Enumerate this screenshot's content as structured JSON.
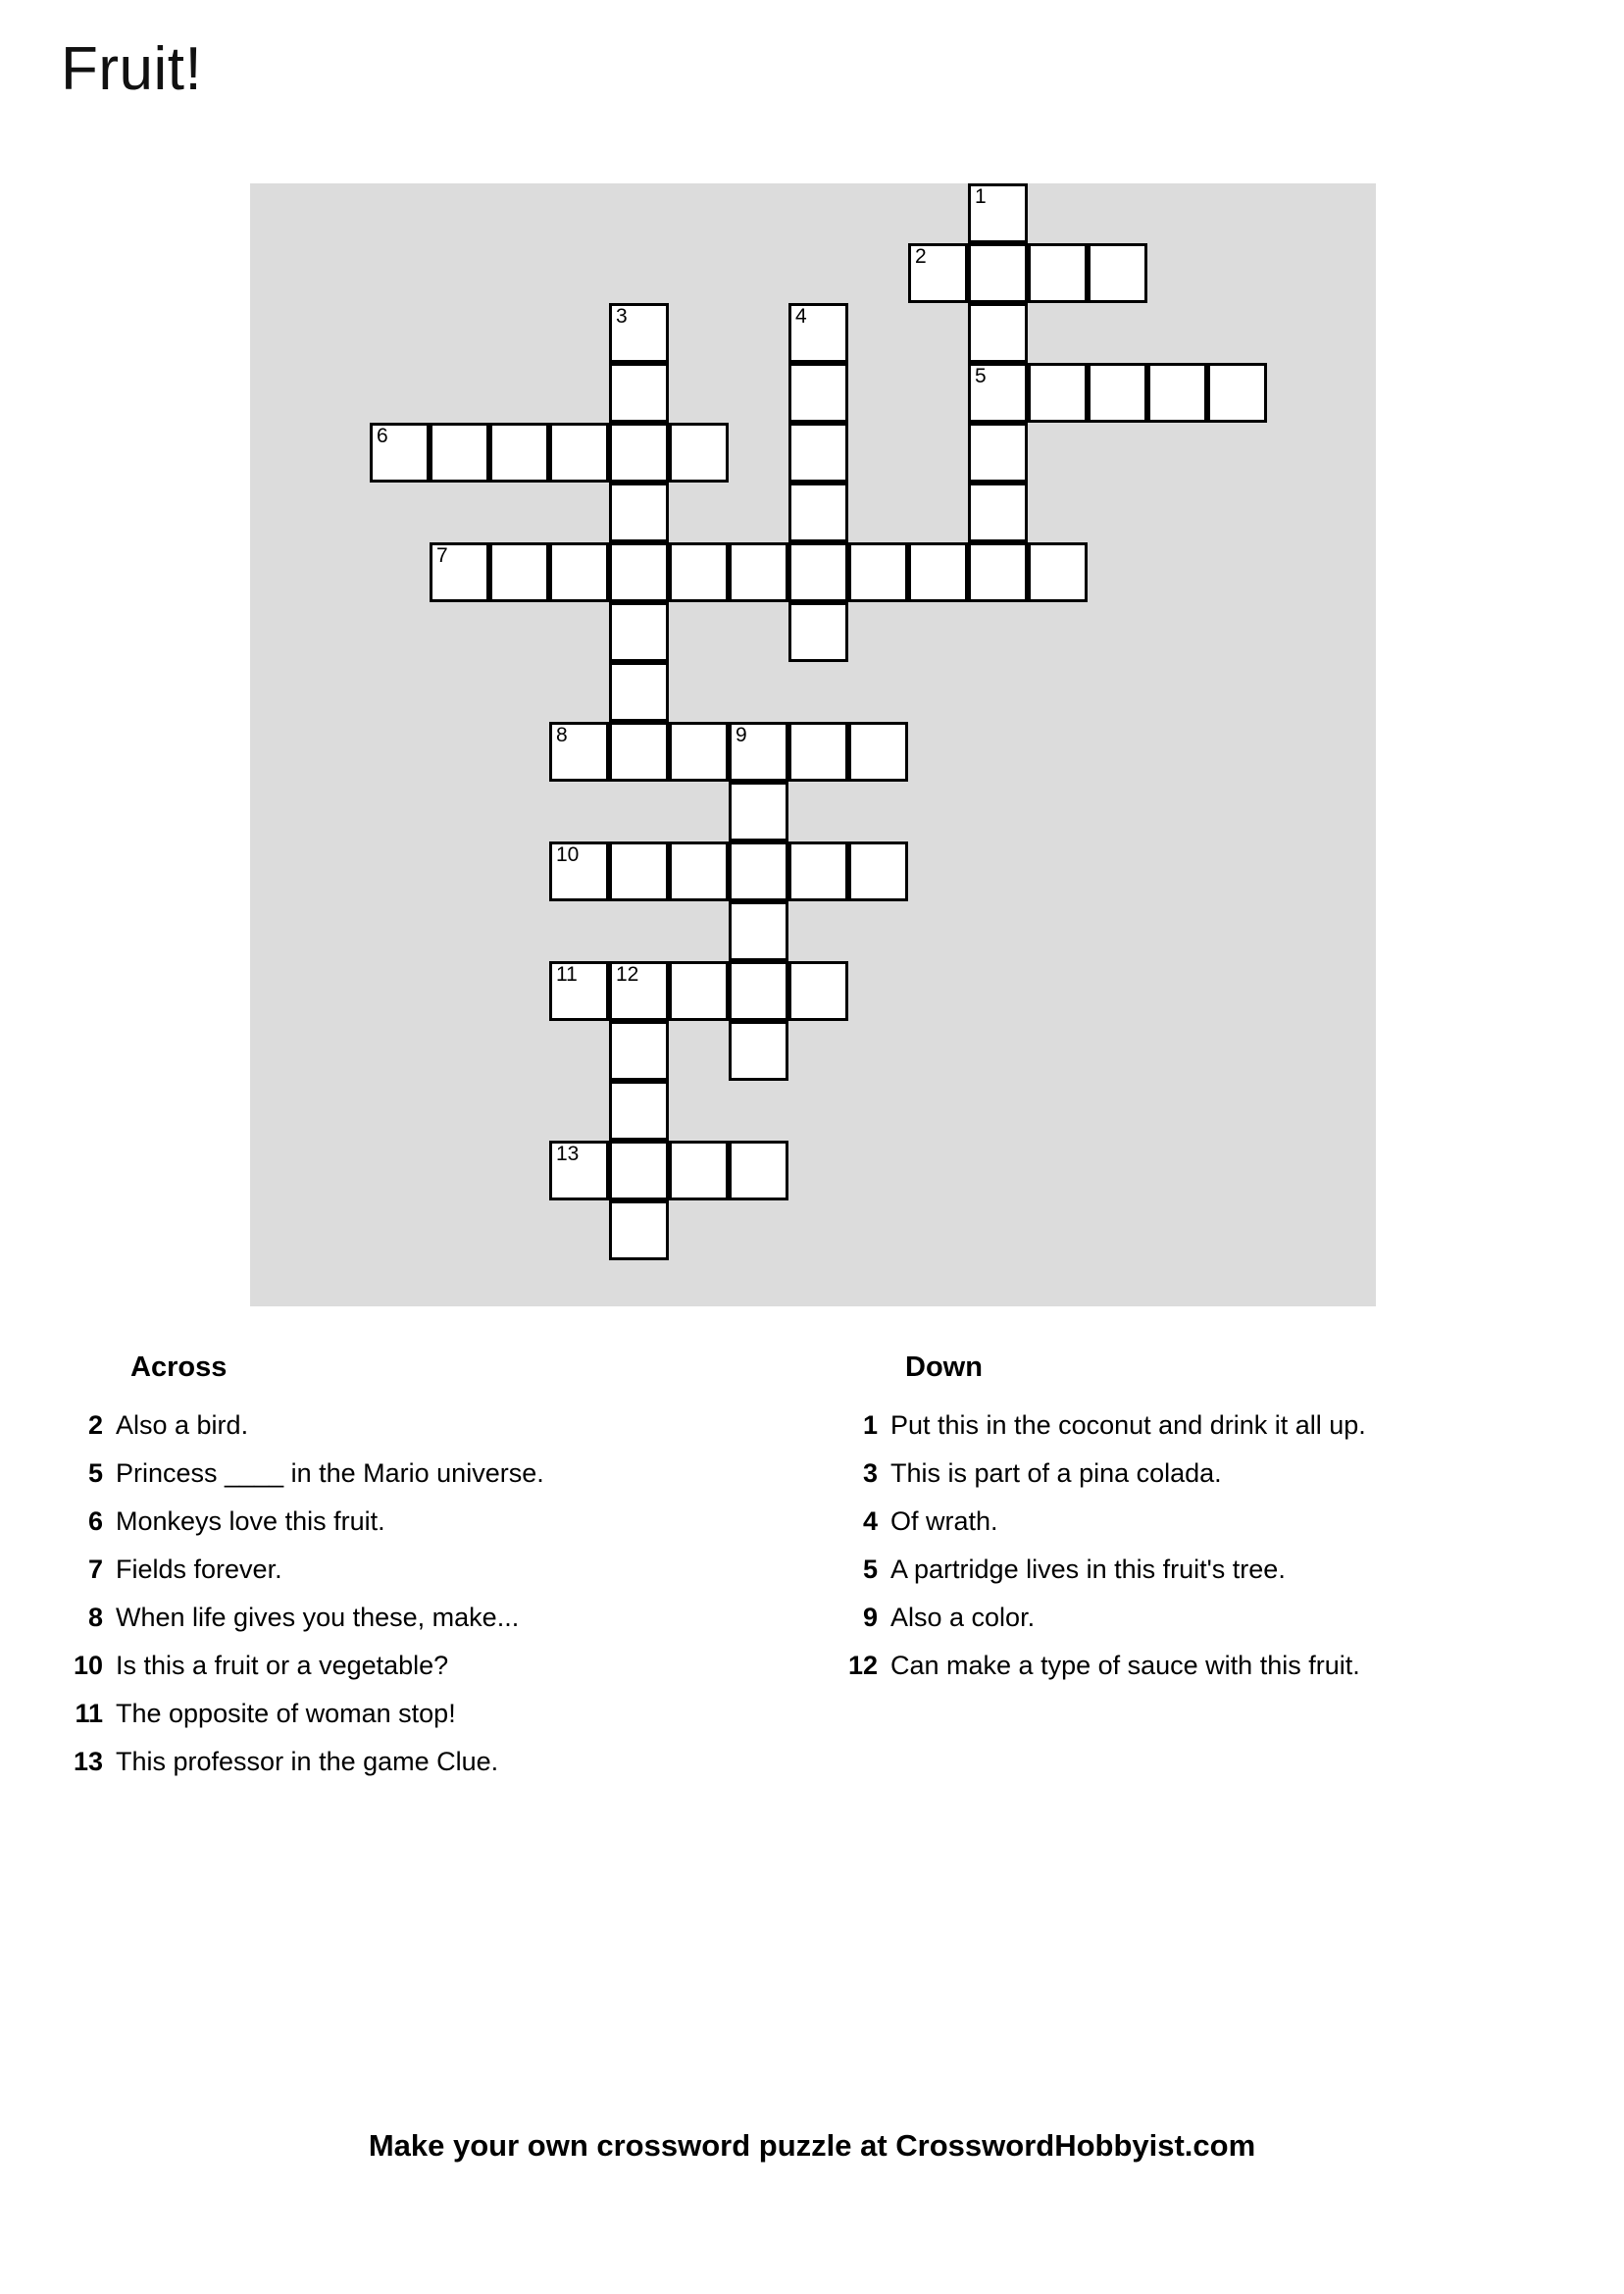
{
  "page": {
    "title": "Fruit!",
    "footer": "Make your own crossword puzzle at CrosswordHobbyist.com",
    "grid_background_color": "#dcdcdc",
    "cell_fill_color": "#ffffff",
    "cell_border_color": "#000000"
  },
  "grid": {
    "cell_size": 61,
    "columns": 19,
    "rows": 19,
    "cells": [
      {
        "row": 0,
        "col": 12,
        "num": "1"
      },
      {
        "row": 1,
        "col": 11,
        "num": "2"
      },
      {
        "row": 1,
        "col": 12,
        "num": ""
      },
      {
        "row": 1,
        "col": 13,
        "num": ""
      },
      {
        "row": 1,
        "col": 14,
        "num": ""
      },
      {
        "row": 2,
        "col": 6,
        "num": "3"
      },
      {
        "row": 2,
        "col": 9,
        "num": "4"
      },
      {
        "row": 2,
        "col": 12,
        "num": ""
      },
      {
        "row": 3,
        "col": 6,
        "num": ""
      },
      {
        "row": 3,
        "col": 9,
        "num": ""
      },
      {
        "row": 3,
        "col": 12,
        "num": "5"
      },
      {
        "row": 3,
        "col": 13,
        "num": ""
      },
      {
        "row": 3,
        "col": 14,
        "num": ""
      },
      {
        "row": 3,
        "col": 15,
        "num": ""
      },
      {
        "row": 3,
        "col": 16,
        "num": ""
      },
      {
        "row": 4,
        "col": 2,
        "num": "6"
      },
      {
        "row": 4,
        "col": 3,
        "num": ""
      },
      {
        "row": 4,
        "col": 4,
        "num": ""
      },
      {
        "row": 4,
        "col": 5,
        "num": ""
      },
      {
        "row": 4,
        "col": 6,
        "num": ""
      },
      {
        "row": 4,
        "col": 7,
        "num": ""
      },
      {
        "row": 4,
        "col": 9,
        "num": ""
      },
      {
        "row": 4,
        "col": 12,
        "num": ""
      },
      {
        "row": 5,
        "col": 6,
        "num": ""
      },
      {
        "row": 5,
        "col": 9,
        "num": ""
      },
      {
        "row": 5,
        "col": 12,
        "num": ""
      },
      {
        "row": 6,
        "col": 3,
        "num": "7"
      },
      {
        "row": 6,
        "col": 4,
        "num": ""
      },
      {
        "row": 6,
        "col": 5,
        "num": ""
      },
      {
        "row": 6,
        "col": 6,
        "num": ""
      },
      {
        "row": 6,
        "col": 7,
        "num": ""
      },
      {
        "row": 6,
        "col": 8,
        "num": ""
      },
      {
        "row": 6,
        "col": 9,
        "num": ""
      },
      {
        "row": 6,
        "col": 10,
        "num": ""
      },
      {
        "row": 6,
        "col": 11,
        "num": ""
      },
      {
        "row": 6,
        "col": 12,
        "num": ""
      },
      {
        "row": 6,
        "col": 13,
        "num": ""
      },
      {
        "row": 7,
        "col": 6,
        "num": ""
      },
      {
        "row": 7,
        "col": 9,
        "num": ""
      },
      {
        "row": 8,
        "col": 6,
        "num": ""
      },
      {
        "row": 9,
        "col": 5,
        "num": "8"
      },
      {
        "row": 9,
        "col": 6,
        "num": ""
      },
      {
        "row": 9,
        "col": 7,
        "num": ""
      },
      {
        "row": 9,
        "col": 8,
        "num": "9"
      },
      {
        "row": 9,
        "col": 9,
        "num": ""
      },
      {
        "row": 9,
        "col": 10,
        "num": ""
      },
      {
        "row": 10,
        "col": 8,
        "num": ""
      },
      {
        "row": 11,
        "col": 5,
        "num": "10"
      },
      {
        "row": 11,
        "col": 6,
        "num": ""
      },
      {
        "row": 11,
        "col": 7,
        "num": ""
      },
      {
        "row": 11,
        "col": 8,
        "num": ""
      },
      {
        "row": 11,
        "col": 9,
        "num": ""
      },
      {
        "row": 11,
        "col": 10,
        "num": ""
      },
      {
        "row": 12,
        "col": 8,
        "num": ""
      },
      {
        "row": 13,
        "col": 5,
        "num": "11"
      },
      {
        "row": 13,
        "col": 6,
        "num": "12"
      },
      {
        "row": 13,
        "col": 7,
        "num": ""
      },
      {
        "row": 13,
        "col": 8,
        "num": ""
      },
      {
        "row": 13,
        "col": 9,
        "num": ""
      },
      {
        "row": 14,
        "col": 6,
        "num": ""
      },
      {
        "row": 14,
        "col": 8,
        "num": ""
      },
      {
        "row": 15,
        "col": 6,
        "num": ""
      },
      {
        "row": 16,
        "col": 5,
        "num": "13"
      },
      {
        "row": 16,
        "col": 6,
        "num": ""
      },
      {
        "row": 16,
        "col": 7,
        "num": ""
      },
      {
        "row": 16,
        "col": 8,
        "num": ""
      },
      {
        "row": 17,
        "col": 6,
        "num": ""
      }
    ]
  },
  "clues": {
    "across": {
      "heading": "Across",
      "items": [
        {
          "num": "2",
          "text": "Also a bird."
        },
        {
          "num": "5",
          "text": "Princess ____ in the Mario universe."
        },
        {
          "num": "6",
          "text": "Monkeys love this fruit."
        },
        {
          "num": "7",
          "text": "Fields forever."
        },
        {
          "num": "8",
          "text": "When life gives you these, make..."
        },
        {
          "num": "10",
          "text": "Is this a fruit or a vegetable?"
        },
        {
          "num": "11",
          "text": "The opposite of woman stop!"
        },
        {
          "num": "13",
          "text": "This professor in the game Clue."
        }
      ]
    },
    "down": {
      "heading": "Down",
      "items": [
        {
          "num": "1",
          "text": "Put this in the coconut and drink it all up."
        },
        {
          "num": "3",
          "text": "This is part of a pina colada."
        },
        {
          "num": "4",
          "text": "Of wrath."
        },
        {
          "num": "5",
          "text": "A partridge lives in this fruit's tree."
        },
        {
          "num": "9",
          "text": "Also a color."
        },
        {
          "num": "12",
          "text": "Can make a type of sauce with this fruit."
        }
      ]
    }
  }
}
